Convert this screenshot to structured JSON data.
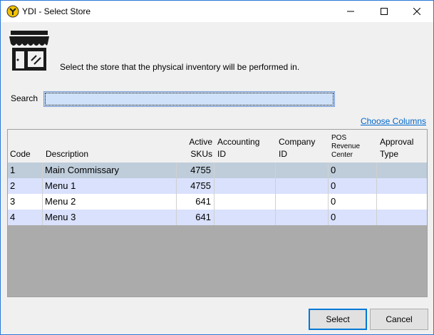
{
  "window": {
    "title": "YDI - Select Store"
  },
  "header": {
    "instruction": "Select the store that the physical inventory will be performed in."
  },
  "search": {
    "label": "Search",
    "value": ""
  },
  "choose_columns_label": "Choose Columns",
  "table": {
    "columns": [
      {
        "key": "code",
        "label": "Code"
      },
      {
        "key": "description",
        "label": "Description"
      },
      {
        "key": "active_skus",
        "label": "Active\nSKUs"
      },
      {
        "key": "accounting_id",
        "label": "Accounting\nID"
      },
      {
        "key": "company_id",
        "label": "Company\nID"
      },
      {
        "key": "pos_revenue_center",
        "label": "POS\nRevenue\nCenter"
      },
      {
        "key": "approval_type",
        "label": "Approval\nType"
      }
    ],
    "rows": [
      {
        "code": "1",
        "description": "Main Commissary",
        "active_skus": "4755",
        "accounting_id": "",
        "company_id": "",
        "pos_revenue_center": "0",
        "approval_type": ""
      },
      {
        "code": "2",
        "description": "Menu 1",
        "active_skus": "4755",
        "accounting_id": "",
        "company_id": "",
        "pos_revenue_center": "0",
        "approval_type": ""
      },
      {
        "code": "3",
        "description": "Menu 2",
        "active_skus": "641",
        "accounting_id": "",
        "company_id": "",
        "pos_revenue_center": "0",
        "approval_type": ""
      },
      {
        "code": "4",
        "description": "Menu 3",
        "active_skus": "641",
        "accounting_id": "",
        "company_id": "",
        "pos_revenue_center": "0",
        "approval_type": ""
      }
    ]
  },
  "buttons": {
    "select": "Select",
    "cancel": "Cancel"
  },
  "colors": {
    "selected_row": "#bfcddb",
    "alt_row": "#d9e1fc",
    "link": "#0066cc",
    "grid_bg": "#ababab"
  }
}
